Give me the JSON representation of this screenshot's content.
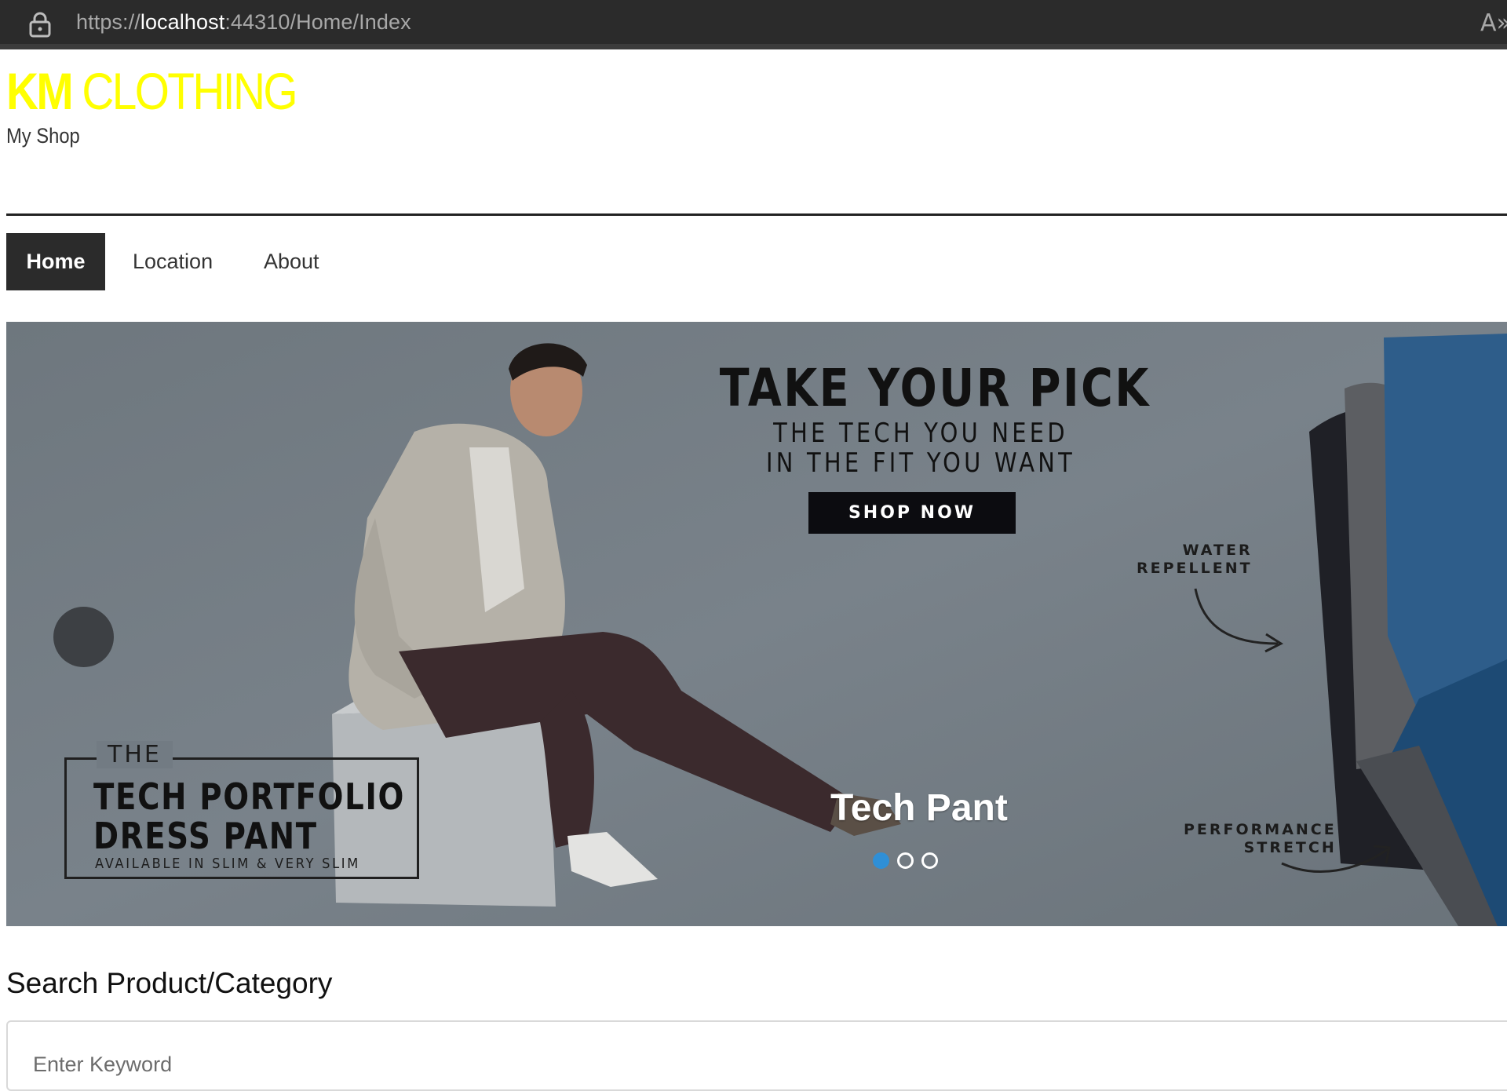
{
  "browser": {
    "url_scheme": "https://",
    "url_host": "localhost",
    "url_rest": ":44310/Home/Index",
    "reader_icon": "A»"
  },
  "header": {
    "brand_strong": "KM",
    "brand_light": "CLOTHING",
    "tagline": "My Shop",
    "brand_color": "#ffff00"
  },
  "nav": {
    "items": [
      {
        "label": "Home",
        "active": true
      },
      {
        "label": "Location",
        "active": false
      },
      {
        "label": "About",
        "active": false
      }
    ]
  },
  "carousel": {
    "headline": "TAKE YOUR PICK",
    "sub1": "THE TECH YOU NEED",
    "sub2": "IN THE FIT YOU WANT",
    "cta": "SHOP NOW",
    "feature1_line1": "WATER",
    "feature1_line2": "REPELLENT",
    "feature2_line1": "PERFORMANCE",
    "feature2_line2": "STRETCH",
    "badge_the": "THE",
    "badge_line1": "TECH PORTFOLIO",
    "badge_line2": "DRESS PANT",
    "badge_avail": "AVAILABLE IN SLIM & VERY SLIM",
    "caption": "Tech Pant",
    "slide_count": 3,
    "active_slide": 1
  },
  "search": {
    "title": "Search Product/Category",
    "placeholder": "Enter Keyword"
  }
}
